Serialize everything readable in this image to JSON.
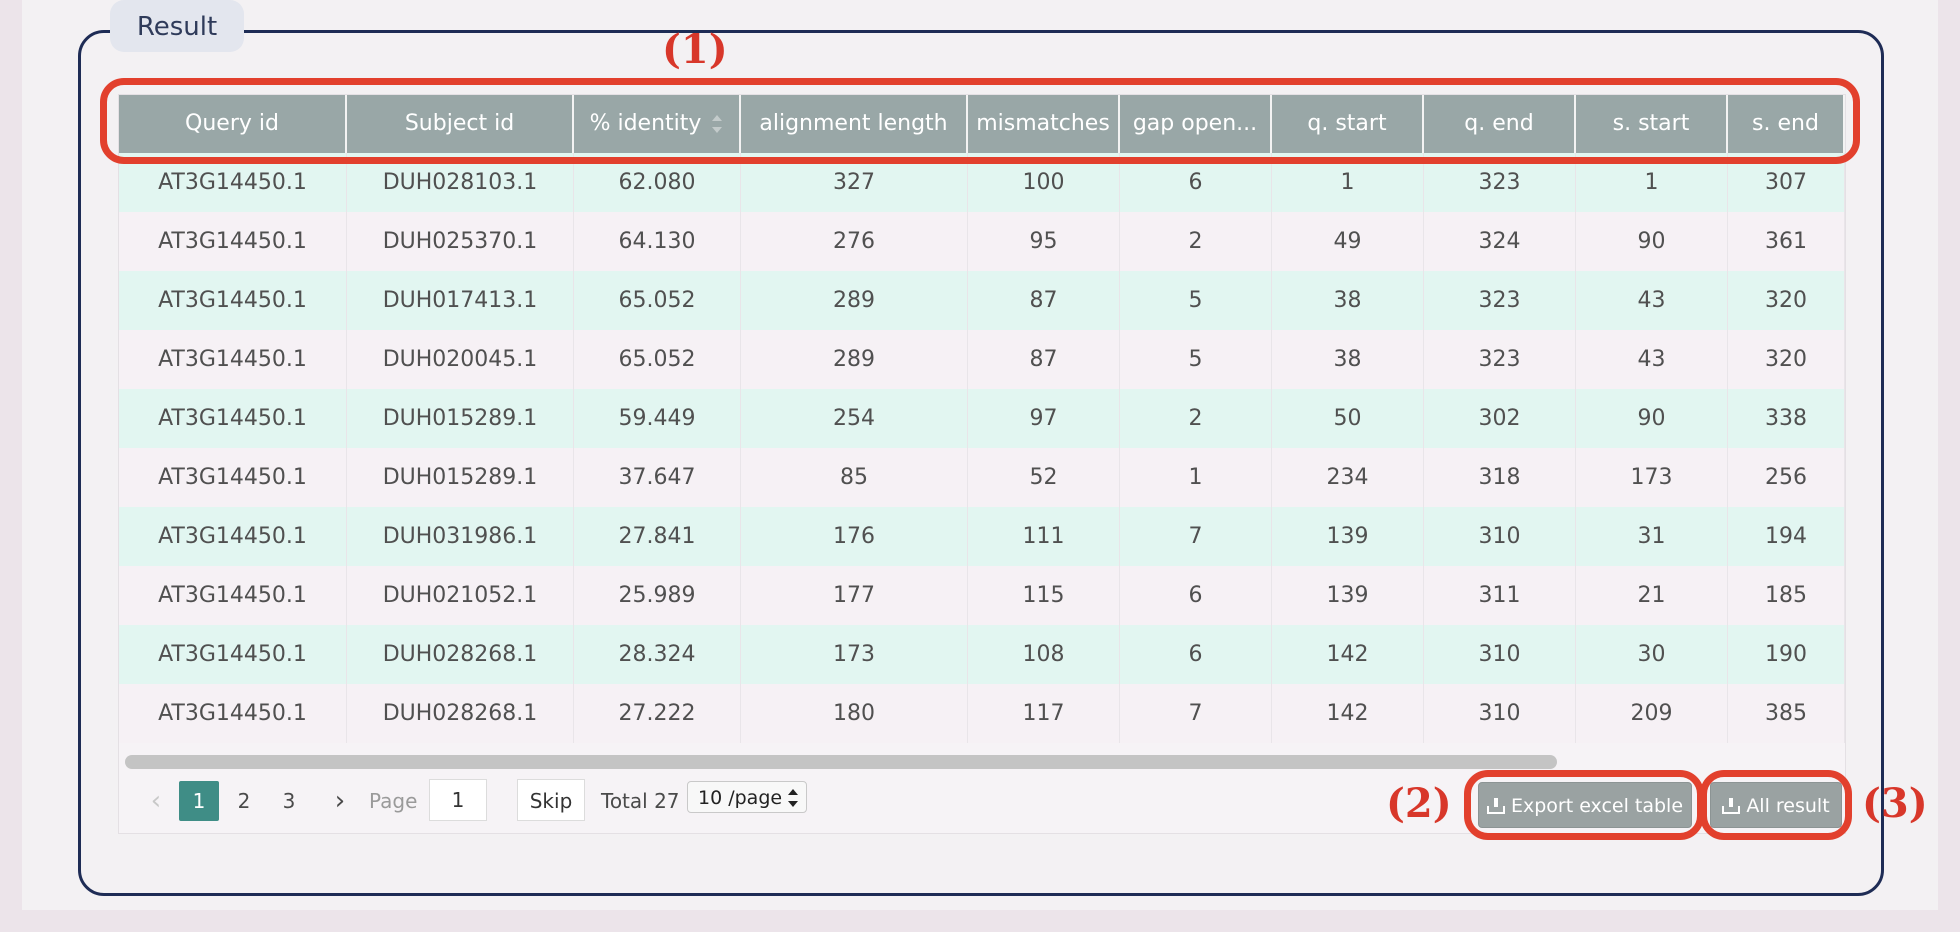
{
  "panel": {
    "title": "Result"
  },
  "table": {
    "columns": [
      {
        "label": "Query id",
        "sortable": false
      },
      {
        "label": "Subject id",
        "sortable": false
      },
      {
        "label": "% identity",
        "sortable": true
      },
      {
        "label": "alignment length",
        "sortable": false
      },
      {
        "label": "mismatches",
        "sortable": false
      },
      {
        "label": "gap open...",
        "sortable": false
      },
      {
        "label": "q. start",
        "sortable": false
      },
      {
        "label": "q. end",
        "sortable": false
      },
      {
        "label": "s. start",
        "sortable": false
      },
      {
        "label": "s. end",
        "sortable": false
      }
    ],
    "rows": [
      [
        "AT3G14450.1",
        "DUH028103.1",
        "62.080",
        "327",
        "100",
        "6",
        "1",
        "323",
        "1",
        "307"
      ],
      [
        "AT3G14450.1",
        "DUH025370.1",
        "64.130",
        "276",
        "95",
        "2",
        "49",
        "324",
        "90",
        "361"
      ],
      [
        "AT3G14450.1",
        "DUH017413.1",
        "65.052",
        "289",
        "87",
        "5",
        "38",
        "323",
        "43",
        "320"
      ],
      [
        "AT3G14450.1",
        "DUH020045.1",
        "65.052",
        "289",
        "87",
        "5",
        "38",
        "323",
        "43",
        "320"
      ],
      [
        "AT3G14450.1",
        "DUH015289.1",
        "59.449",
        "254",
        "97",
        "2",
        "50",
        "302",
        "90",
        "338"
      ],
      [
        "AT3G14450.1",
        "DUH015289.1",
        "37.647",
        "85",
        "52",
        "1",
        "234",
        "318",
        "173",
        "256"
      ],
      [
        "AT3G14450.1",
        "DUH031986.1",
        "27.841",
        "176",
        "111",
        "7",
        "139",
        "310",
        "31",
        "194"
      ],
      [
        "AT3G14450.1",
        "DUH021052.1",
        "25.989",
        "177",
        "115",
        "6",
        "139",
        "311",
        "21",
        "185"
      ],
      [
        "AT3G14450.1",
        "DUH028268.1",
        "28.324",
        "173",
        "108",
        "6",
        "142",
        "310",
        "30",
        "190"
      ],
      [
        "AT3G14450.1",
        "DUH028268.1",
        "27.222",
        "180",
        "117",
        "7",
        "142",
        "310",
        "209",
        "385"
      ]
    ]
  },
  "pagination": {
    "prev_icon": "chevron-left-icon",
    "next_icon": "chevron-right-icon",
    "pages": [
      "1",
      "2",
      "3"
    ],
    "current_page": "1",
    "page_label": "Page",
    "page_input_value": "1",
    "skip_label": "Skip",
    "total_label": "Total 27",
    "page_size_selected": "10 /page"
  },
  "actions": {
    "export_label": "Export excel table",
    "all_result_label": "All result"
  },
  "annotations": {
    "one": "(1)",
    "two": "(2)",
    "three": "(3)"
  },
  "colors": {
    "header_bg": "#99a7a7",
    "row_even_bg": "#e2f6f1",
    "row_odd_bg": "#f6f1f5",
    "active_page": "#3f8d86",
    "annotation_red": "#e2402d",
    "frame_border": "#1e2c55"
  }
}
